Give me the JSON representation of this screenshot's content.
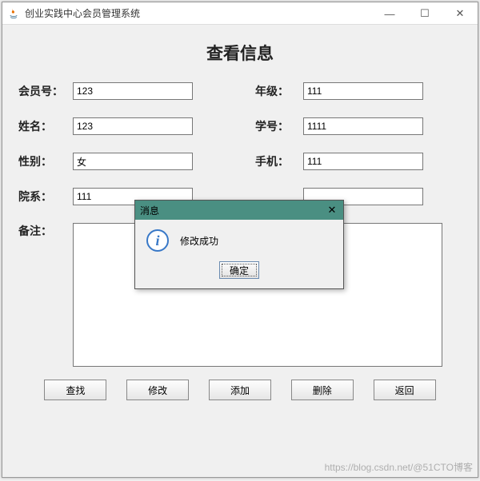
{
  "window": {
    "title": "创业实践中心会员管理系统"
  },
  "heading": "查看信息",
  "labels": {
    "member_id": "会员号：",
    "grade": "年级：",
    "name": "姓名：",
    "student_id": "学号：",
    "gender": "性别：",
    "phone": "手机：",
    "department": "院系：",
    "remarks": "备注："
  },
  "values": {
    "member_id": "123",
    "grade": "111",
    "name": "123",
    "student_id": "1111",
    "gender": "女",
    "phone": "111",
    "department": "111",
    "dept_right": "",
    "remarks": ""
  },
  "buttons": {
    "search": "查找",
    "modify": "修改",
    "add": "添加",
    "delete": "删除",
    "back": "返回"
  },
  "dialog": {
    "title": "消息",
    "message": "修改成功",
    "ok": "确定"
  },
  "watermark": "https://blog.csdn.net/@51CTO博客"
}
